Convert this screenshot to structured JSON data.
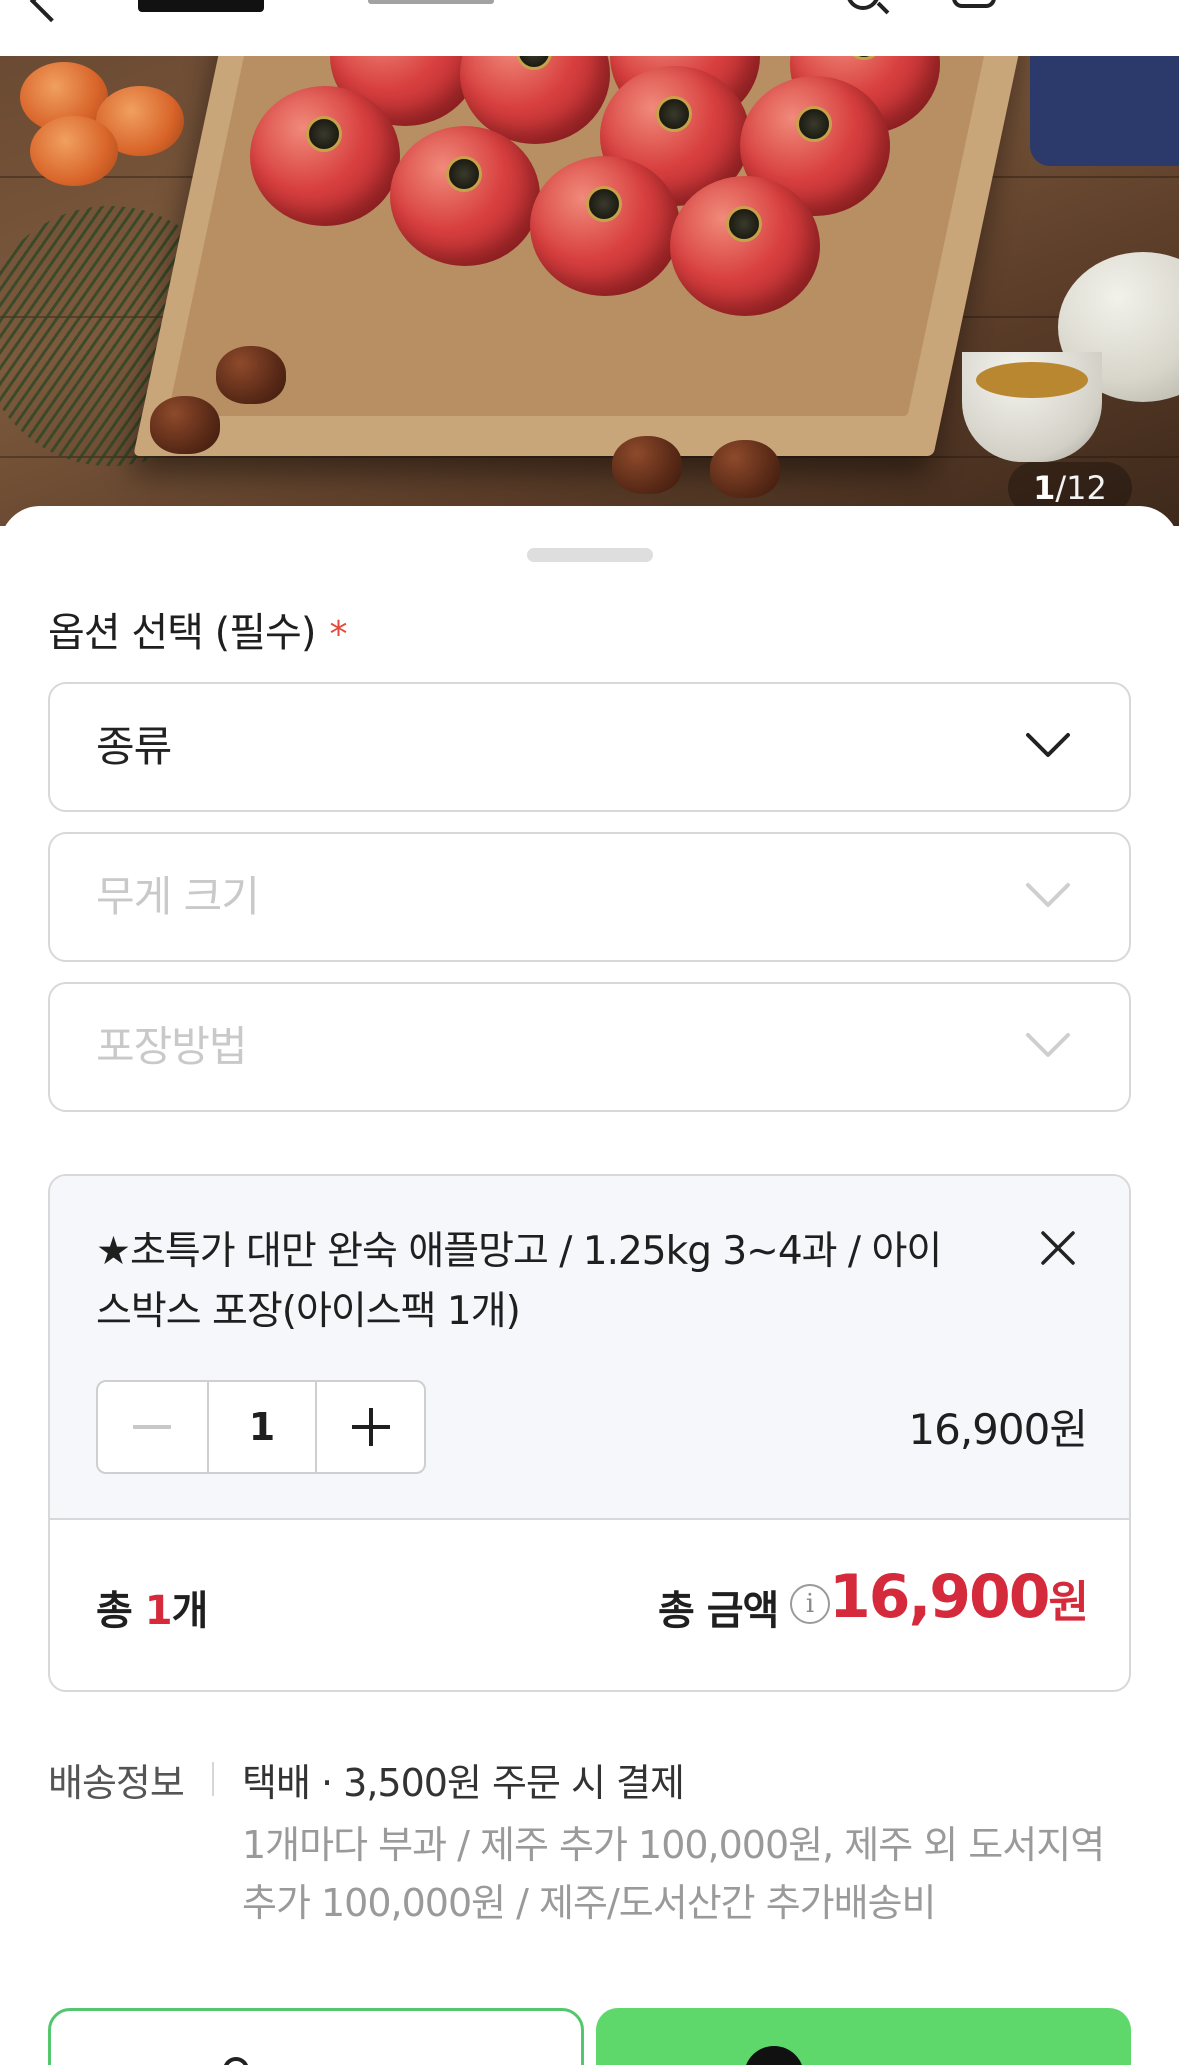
{
  "hero": {
    "counter_current": "1",
    "counter_sep": "/",
    "counter_total": "12"
  },
  "options": {
    "title": "옵션 선택 (필수)",
    "required_mark": "*",
    "selects": [
      {
        "label": "종류",
        "enabled": true
      },
      {
        "label": "무게 크기",
        "enabled": false
      },
      {
        "label": "포장방법",
        "enabled": false
      }
    ]
  },
  "selected_item": {
    "name": "★초특가 대만 완숙 애플망고 / 1.25kg 3~4과 / 아이스박스 포장(아이스팩 1개)",
    "quantity": "1",
    "price": "16,900원"
  },
  "summary": {
    "count_prefix": "총 ",
    "count_value": "1",
    "count_suffix": "개",
    "total_label": "총 금액",
    "info_icon_glyph": "i",
    "total_amount": "16,900",
    "total_currency": "원",
    "accent_color": "#d42a3b"
  },
  "shipping": {
    "label": "배송정보",
    "main": "택배 · 3,500원 주문 시 결제",
    "sub": "1개마다 부과 / 제주 추가 100,000원, 제주 외 도서지역 추가 100,000원 / 제주/도서산간 추가배송비"
  },
  "buttons": {
    "gift_label": "",
    "buy_label": "",
    "buy_color": "#5ed86a"
  }
}
